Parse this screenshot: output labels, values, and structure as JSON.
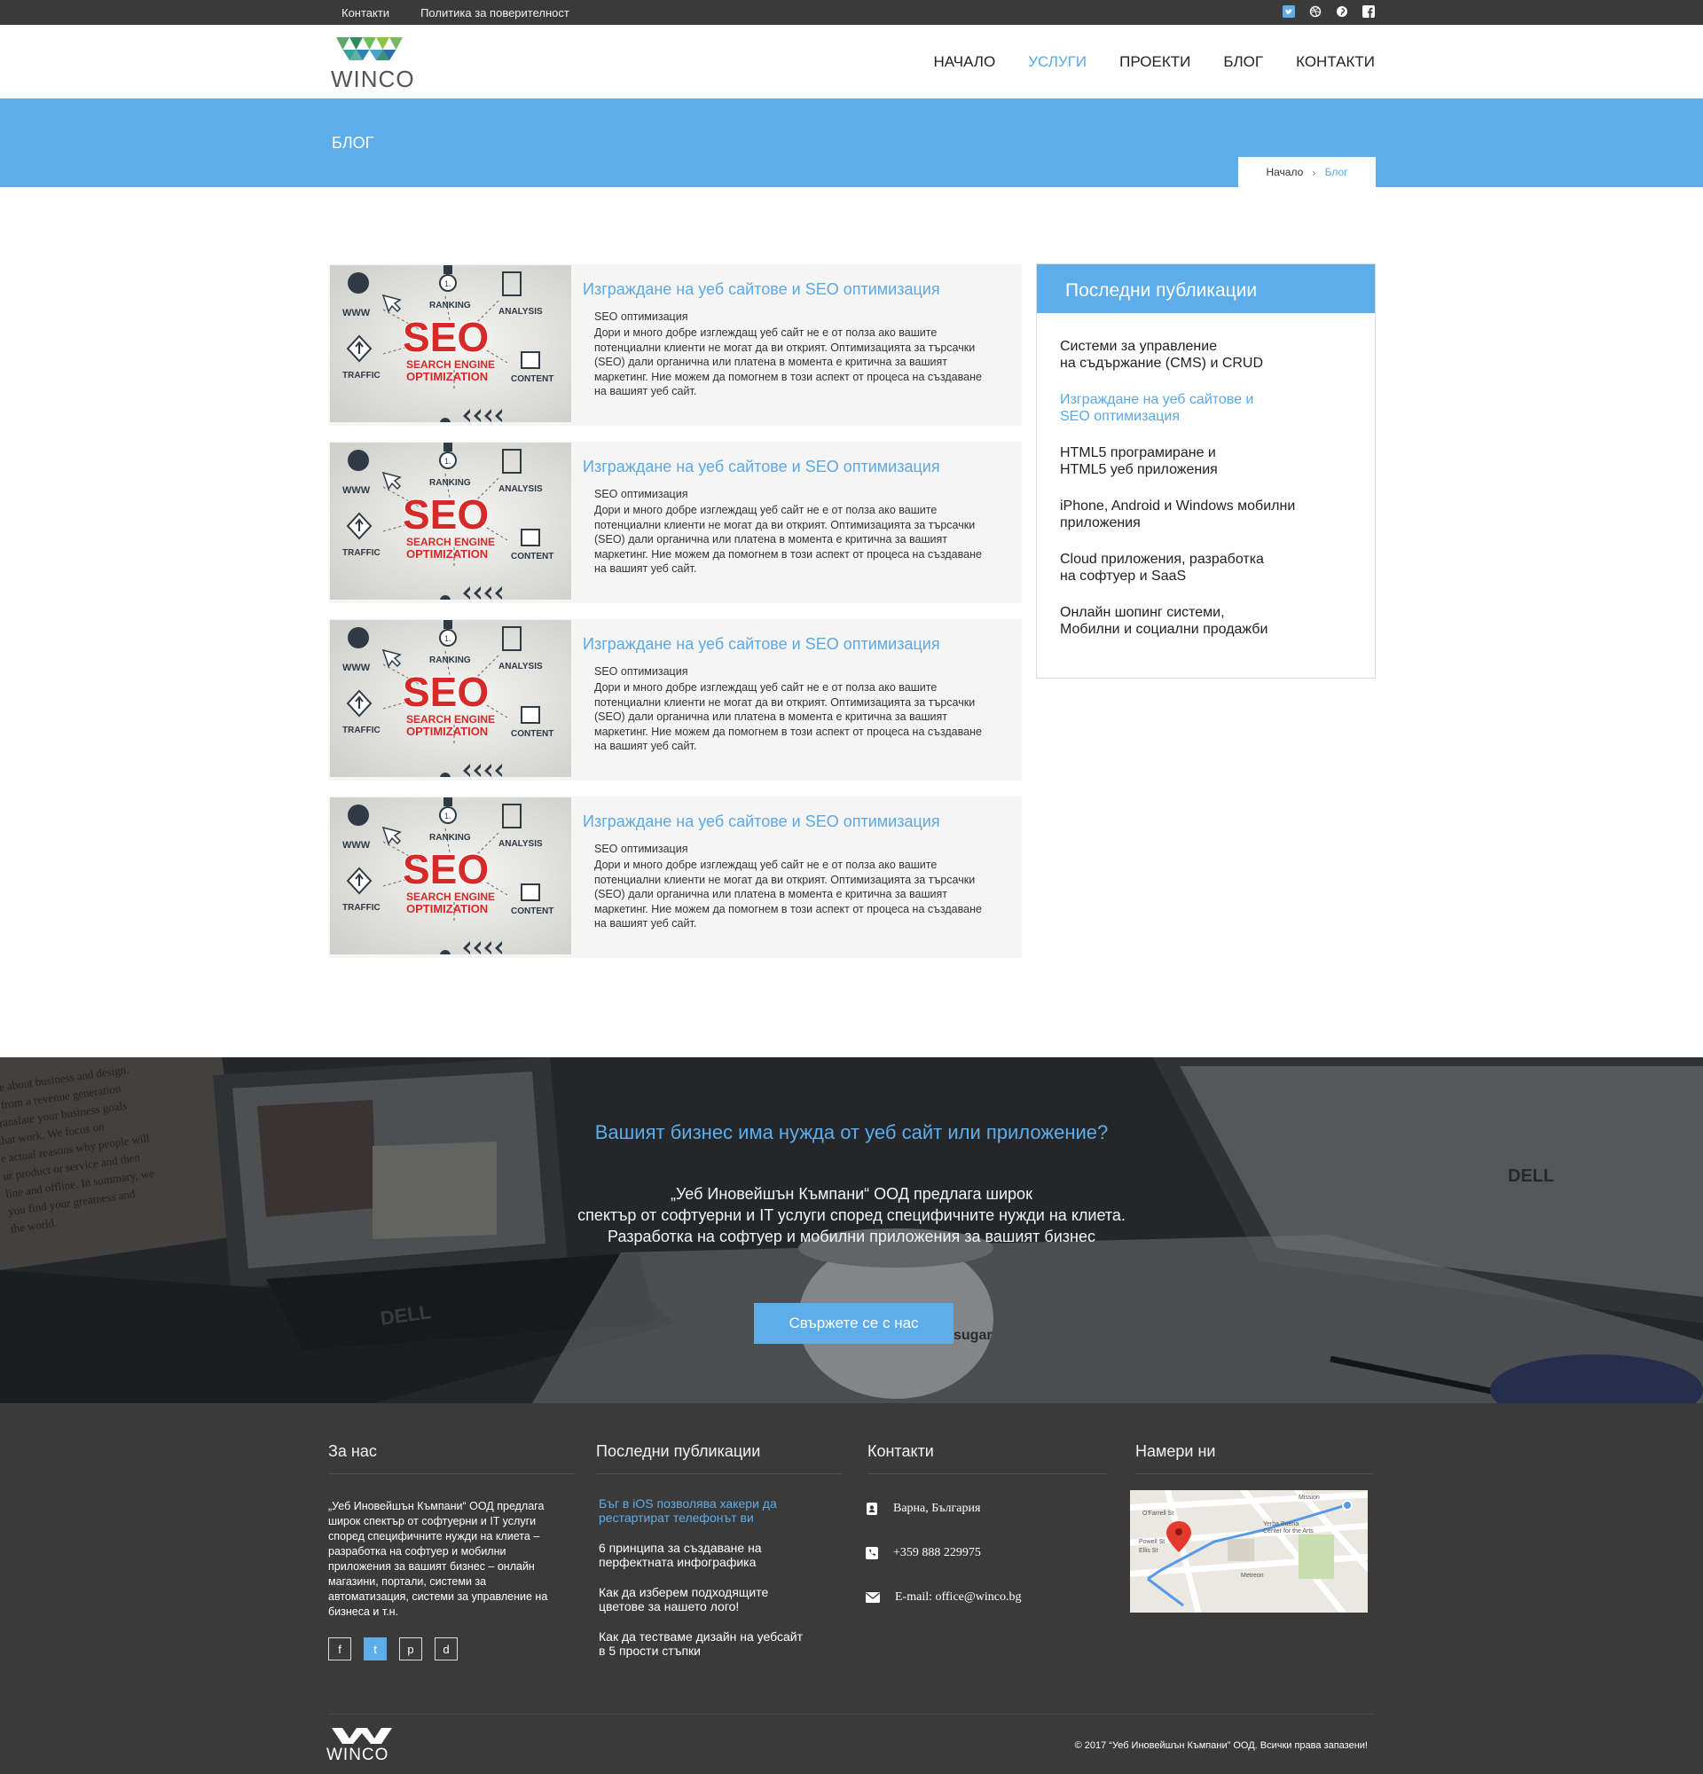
{
  "topbar": {
    "links": [
      "Контакти",
      "Политика за поверителност"
    ],
    "social_icons": [
      "twitter-icon",
      "dribbble-icon",
      "pinterest-icon",
      "facebook-icon"
    ]
  },
  "header": {
    "logo_text": "WINCO",
    "nav": [
      {
        "label": "НАЧАЛО",
        "active": false
      },
      {
        "label": "УСЛУГИ",
        "active": true
      },
      {
        "label": "ПРОЕКТИ",
        "active": false
      },
      {
        "label": "БЛОГ",
        "active": false
      },
      {
        "label": "КОНТАКТИ",
        "active": false
      }
    ]
  },
  "page": {
    "title": "БЛОГ",
    "breadcrumb": {
      "home": "Начало",
      "current": "Блог"
    }
  },
  "thumb": {
    "words": {
      "www": "WWW",
      "ranking": "RANKING",
      "analysis": "ANALYSIS",
      "seo": "SEO",
      "line1": "SEARCH ENGINE",
      "line2": "OPTIMIZATION",
      "traffic": "TRAFFIC",
      "content": "CONTENT",
      "badge": "1."
    }
  },
  "posts": [
    {
      "title": "Изграждане на уеб сайтове и SEO оптимизация",
      "subtitle": "SEO оптимизация",
      "excerpt": "Дори и много добре изглеждащ уеб сайт не е от полза ако вашите потенциални клиенти не могат да ви открият. Оптимизацията за търсачки (SEO) дали органична или платена в момента е критична за вашият маркетинг. Ние можем да помогнем в този аспект от процеса на създаване на вашият уеб сайт."
    },
    {
      "title": "Изграждане на уеб сайтове и SEO оптимизация",
      "subtitle": "SEO оптимизация",
      "excerpt": "Дори и много добре изглеждащ уеб сайт не е от полза ако вашите потенциални клиенти не могат да ви открият. Оптимизацията за търсачки (SEO) дали органична или платена в момента е критична за вашият маркетинг. Ние можем да помогнем в този аспект от процеса на създаване на вашият уеб сайт."
    },
    {
      "title": "Изграждане на уеб сайтове и SEO оптимизация",
      "subtitle": "SEO оптимизация",
      "excerpt": "Дори и много добре изглеждащ уеб сайт не е от полза ако вашите потенциални клиенти не могат да ви открият. Оптимизацията за търсачки (SEO) дали органична или платена в момента е критична за вашият маркетинг. Ние можем да помогнем в този аспект от процеса на създаване на вашият уеб сайт."
    },
    {
      "title": "Изграждане на уеб сайтове и SEO оптимизация",
      "subtitle": "SEO оптимизация",
      "excerpt": "Дори и много добре изглеждащ уеб сайт не е от полза ако вашите потенциални клиенти не могат да ви открият. Оптимизацията за търсачки (SEO) дали органична или платена в момента е критична за вашият маркетинг. Ние можем да помогнем в този аспект от процеса на създаване на вашият уеб сайт."
    }
  ],
  "sidebar": {
    "title": "Последни публикации",
    "items": [
      {
        "label": "Системи за управление\nна съдържание (CMS) и CRUD",
        "active": false
      },
      {
        "label": "Изграждане на уеб сайтове и\nSEO оптимизация",
        "active": true
      },
      {
        "label": "HTML5 програмиране и\nHTML5 уеб приложения",
        "active": false
      },
      {
        "label": "iPhone, Android и Windows мобилни\nприложения",
        "active": false
      },
      {
        "label": "Cloud приложения, разработка\nна софтуер и SaaS",
        "active": false
      },
      {
        "label": "Онлайн шопинг системи,\nМобилни и социални продажби",
        "active": false
      }
    ]
  },
  "cta": {
    "title": "Вашият бизнес има нужда от уеб сайт или приложение?",
    "text": "„Уеб Иновейшън Къмпани“ ООД предлага широк\nспектър от софтуерни и IT услуги според специфичните нужди на клиета.\nРазработка на софтуер и мобилни приложения за вашият бизнес",
    "button": "Свържете се с нас",
    "photo_book_lines": [
      "ate about business and design.",
      "s from a revenue generation",
      "translate your business goals",
      "that work. We focus on",
      "e actual reasons why people will",
      "ur product or service and then",
      "line and offline. In summary, we",
      "you find your greatness and",
      "the world."
    ],
    "photo_brands": [
      "DELL",
      "DELL",
      "sugar"
    ]
  },
  "footer": {
    "about_title": "За нас",
    "about_text": "„Уеб Иновейшън Къмпани“ ООД предлага широк спектър от софтуерни и IT услуги според специфичните нужди на клиета – разработка на софтуер и мобилни приложения за вашият бизнес – онлайн магазини, портали, системи за автоматизация, системи за управление на бизнеса и т.н.",
    "social": [
      "f",
      "t",
      "p",
      "d"
    ],
    "posts_title": "Последни публикации",
    "posts": [
      {
        "label": "Бъг в iOS позволява хакери да\nрестартират телефонът ви",
        "active": true
      },
      {
        "label": "6 принципа за създаване на\nперфектната инфографика",
        "active": false
      },
      {
        "label": "Как да изберем подходящите\nцветове за нашето лого!",
        "active": false
      },
      {
        "label": "Как да тестваме дизайн на уебсайт\nв 5 прости стъпки",
        "active": false
      }
    ],
    "contacts_title": "Контакти",
    "address": "Варна, България",
    "phone": "+359 888 229975",
    "email": "E-mail: office@winco.bg",
    "map_title": "Намери ни",
    "map_labels": {
      "s1": "O'Farrell St",
      "s2": "Ellis St",
      "s3": "Powell St",
      "place": "Metreon",
      "venue1": "Yerba Buena",
      "venue2": "Center for the Arts",
      "s4": "Mission"
    },
    "logo_text": "WINCO",
    "copyright": "© 2017 “Уеб Иновейшън Къмпани” ООД. Всички права запазени!"
  },
  "colors": {
    "accent": "#5dadea",
    "dark": "#3a3a3a",
    "seo_red": "#d42a2a"
  }
}
